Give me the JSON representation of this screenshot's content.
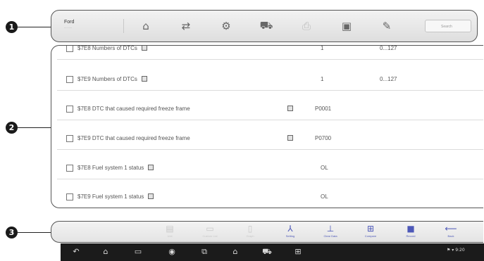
{
  "callouts": [
    "1",
    "2",
    "3"
  ],
  "toolbar": {
    "vehicle_make": "Ford",
    "vehicle_sub": "..........",
    "buttons": [
      {
        "name": "home-icon",
        "glyph": "⌂"
      },
      {
        "name": "vehicle-swap-icon",
        "glyph": "⇄"
      },
      {
        "name": "settings-icon",
        "glyph": "⚙"
      },
      {
        "name": "vci-icon",
        "glyph": "⛟"
      },
      {
        "name": "print-icon",
        "glyph": "⎙"
      },
      {
        "name": "save-icon",
        "glyph": "▣"
      },
      {
        "name": "tools-icon",
        "glyph": "✎"
      }
    ],
    "search_placeholder": "Search"
  },
  "data_list": {
    "rows": [
      {
        "name": "$7E8 Numbers of DTCs",
        "value": "1",
        "range": "0...127"
      },
      {
        "name": "$7E9 Numbers of DTCs",
        "value": "1",
        "range": "0...127"
      },
      {
        "name": "$7E8 DTC that caused required freeze frame",
        "value": "P0001",
        "range": ""
      },
      {
        "name": "$7E9 DTC that caused required freeze frame",
        "value": "P0700",
        "range": ""
      },
      {
        "name": "$7E8 Fuel system 1 status",
        "value": "OL",
        "range": ""
      },
      {
        "name": "$7E9 Fuel system 1 status",
        "value": "OL",
        "range": ""
      }
    ]
  },
  "function_bar": {
    "buttons": [
      {
        "name": "fn-button-1",
        "label": "Unit",
        "glyph": "▤",
        "state": "inactive"
      },
      {
        "name": "fn-button-2",
        "label": "Custom List",
        "glyph": "▭",
        "state": "inactive"
      },
      {
        "name": "fn-button-3",
        "label": "Graph",
        "glyph": "▯",
        "state": "inactive"
      },
      {
        "name": "fn-button-4",
        "label": "Setting",
        "glyph": "⅄",
        "state": "active"
      },
      {
        "name": "fn-button-5",
        "label": "Clear Data",
        "glyph": "⊥",
        "state": "active"
      },
      {
        "name": "fn-button-6",
        "label": "Compare",
        "glyph": "⊞",
        "state": "active"
      },
      {
        "name": "fn-button-7",
        "label": "Record",
        "glyph": "■",
        "state": "active"
      },
      {
        "name": "fn-button-8",
        "label": "Back",
        "glyph": "⟵",
        "state": "active"
      }
    ]
  },
  "system_bar": {
    "icons": [
      {
        "name": "back-icon",
        "glyph": "↶"
      },
      {
        "name": "home-icon",
        "glyph": "⌂"
      },
      {
        "name": "recent-apps-icon",
        "glyph": "▭"
      },
      {
        "name": "chrome-icon",
        "glyph": "◉"
      },
      {
        "name": "screenshot-icon",
        "glyph": "⧉"
      },
      {
        "name": "autel-home-icon",
        "glyph": "⌂"
      },
      {
        "name": "vci-icon",
        "glyph": "⛟"
      },
      {
        "name": "network-icon",
        "glyph": "⊞"
      }
    ],
    "status": "⚑ ▾ 9:20"
  }
}
